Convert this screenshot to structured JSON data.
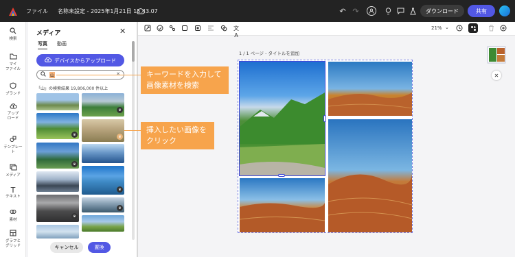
{
  "topbar": {
    "file_label": "ファイル",
    "doc_title": "名称未設定 - 2025年1月21日 15.43.07",
    "download_label": "ダウンロード",
    "share_label": "共有"
  },
  "rail": {
    "items": [
      {
        "label": "検索",
        "icon": "search-icon"
      },
      {
        "label": "マイ\nファイル",
        "icon": "folder-icon"
      },
      {
        "label": "ブランド",
        "icon": "brand-icon"
      },
      {
        "label": "アップ\nロード",
        "icon": "upload-icon"
      },
      {
        "label": "テンプレー\nト",
        "icon": "template-icon"
      },
      {
        "label": "メディア",
        "icon": "media-icon"
      },
      {
        "label": "テキスト",
        "icon": "text-icon"
      },
      {
        "label": "素材",
        "icon": "elements-icon"
      },
      {
        "label": "グラフと\nグリッド",
        "icon": "grid-icon"
      }
    ]
  },
  "panel": {
    "title": "メディア",
    "tabs": [
      "写真",
      "動画"
    ],
    "upload_label": "デバイスからアップロード",
    "search_value": "山",
    "result_text": "「山」の検索結果 19,806,000 件以上",
    "cancel_label": "キャンセル",
    "replace_label": "置換"
  },
  "toolbar": {
    "zoom": "21%"
  },
  "canvas": {
    "page_label": "1 / 1 ページ - タイトルを追加"
  },
  "callouts": {
    "search": "キーワードを入力して\n画像素材を検索",
    "insert": "挿入したい画像を\nクリック"
  },
  "colors": {
    "accent": "#5258e4",
    "callout": "#f7a44c",
    "topbar": "#232323"
  }
}
